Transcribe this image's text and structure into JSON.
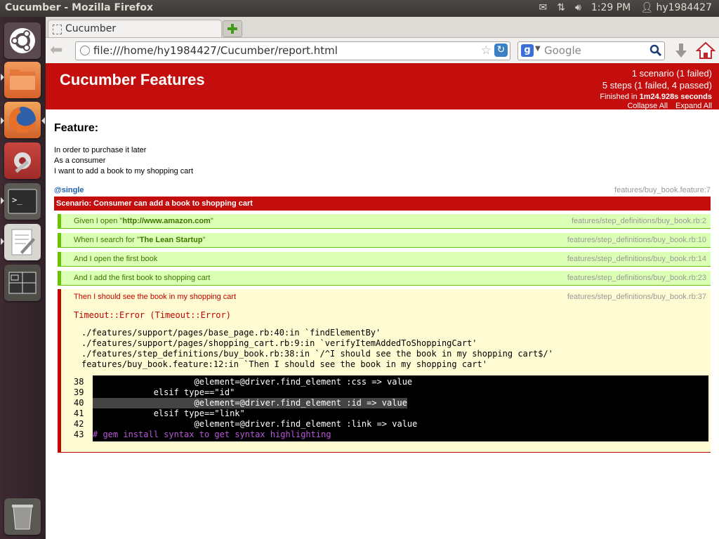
{
  "toppanel": {
    "window_title": "Cucumber - Mozilla Firefox",
    "time": "1:29 PM",
    "user": "hy1984427"
  },
  "launcher": {
    "items": [
      {
        "name": "dash-home",
        "icon": "ubuntu-logo-icon"
      },
      {
        "name": "files",
        "icon": "folder-icon"
      },
      {
        "name": "firefox",
        "icon": "firefox-icon"
      },
      {
        "name": "system-settings",
        "icon": "settings-icon"
      },
      {
        "name": "terminal",
        "icon": "terminal-icon"
      },
      {
        "name": "text-editor",
        "icon": "text-editor-icon"
      },
      {
        "name": "workspace-switcher",
        "icon": "workspace-icon"
      },
      {
        "name": "trash",
        "icon": "trash-icon"
      }
    ]
  },
  "browser": {
    "tab_title": "Cucumber",
    "url": "file:///home/hy1984427/Cucumber/report.html",
    "search_placeholder": "Google"
  },
  "report": {
    "title": "Cucumber Features",
    "summary_scenarios": "1 scenario (1 failed)",
    "summary_steps": "5 steps (1 failed, 4 passed)",
    "finished_prefix": "Finished in ",
    "finished_time": "1m24.928s seconds",
    "collapse_all": "Collapse All",
    "expand_all": "Expand All",
    "colors": {
      "failed": "#c40d0d",
      "passed_bg": "#dbffb4",
      "passed_border": "#65c400",
      "failed_bg": "#fffbd3"
    }
  },
  "feature": {
    "heading": "Feature:",
    "narrative": [
      "In order to purchase it later",
      "As a consumer",
      "I want to add a book to my shopping cart"
    ],
    "tag": "@single",
    "scenario_location": "features/buy_book.feature:7",
    "scenario_title": "Scenario: Consumer can add a book to shopping cart"
  },
  "steps": [
    {
      "prefix": "Given I open \"",
      "arg": "http://www.amazon.com",
      "suffix": "\"",
      "location": "features/step_definitions/buy_book.rb:2",
      "status": "passed"
    },
    {
      "prefix": "When I search for \"",
      "arg": "The Lean Startup",
      "suffix": "\"",
      "location": "features/step_definitions/buy_book.rb:10",
      "status": "passed"
    },
    {
      "prefix": "And I open the first book",
      "arg": "",
      "suffix": "",
      "location": "features/step_definitions/buy_book.rb:14",
      "status": "passed"
    },
    {
      "prefix": "And I add the first book to shopping cart",
      "arg": "",
      "suffix": "",
      "location": "features/step_definitions/buy_book.rb:23",
      "status": "passed"
    }
  ],
  "failed_step": {
    "text": "Then I should see the book in my shopping cart",
    "location": "features/step_definitions/buy_book.rb:37",
    "error": "Timeout::Error (Timeout::Error)",
    "backtrace": [
      "./features/support/pages/base_page.rb:40:in `findElementBy'",
      "./features/support/pages/shopping_cart.rb:9:in `verifyItemAddedToShoppingCart'",
      "./features/step_definitions/buy_book.rb:38:in `/^I should see the book in my shopping cart$/'",
      "features/buy_book.feature:12:in `Then I should see the book in my shopping cart'"
    ],
    "snippet": [
      {
        "line": "38",
        "code": "                    @element=@driver.find_element :css => value"
      },
      {
        "line": "39",
        "code": "            elsif type==\"id\""
      },
      {
        "line": "40",
        "code": "                    @element=@driver.find_element :id => value"
      },
      {
        "line": "41",
        "code": "            elsif type==\"link\""
      },
      {
        "line": "42",
        "code": "                    @element=@driver.find_element :link => value"
      },
      {
        "line": "43",
        "code": "# gem install syntax to get syntax highlighting"
      }
    ]
  }
}
